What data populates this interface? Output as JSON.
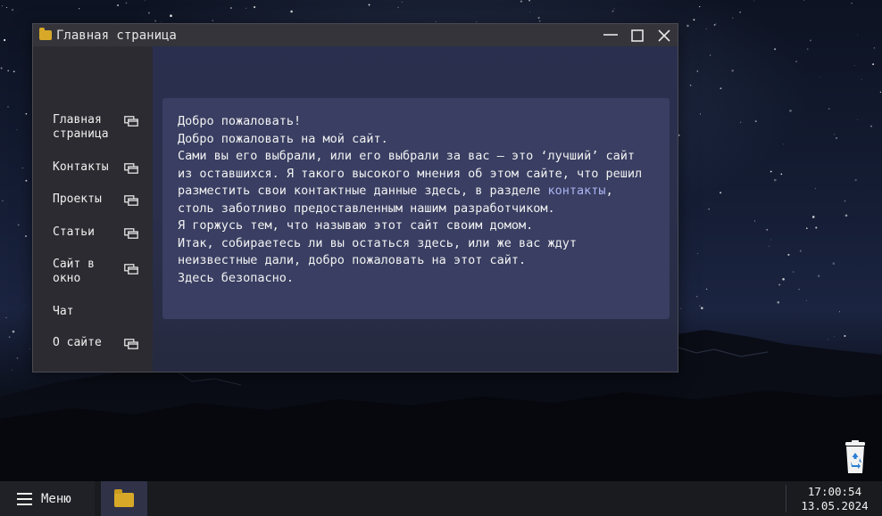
{
  "window": {
    "title": "Главная страница"
  },
  "sidebar": {
    "items": [
      {
        "label": "Главная страница",
        "icon": "window-icon"
      },
      {
        "label": "Контакты",
        "icon": "window-icon"
      },
      {
        "label": "Проекты",
        "icon": "window-icon"
      },
      {
        "label": "Статьи",
        "icon": "window-icon"
      },
      {
        "label": "Сайт в окно",
        "icon": "window-icon"
      },
      {
        "label": "Чат",
        "icon": ""
      },
      {
        "label": "О сайте",
        "icon": "window-icon"
      }
    ]
  },
  "content": {
    "line1": "Добро пожаловать!",
    "line2": "Добро пожаловать на мой сайт.",
    "para_a": "Сами вы его выбрали, или его выбрали за вас — это ‘лучший’ сайт из оставшихся. Я такого высокого мнения об этом сайте, что решил разместить свои контактные данные здесь, в разделе",
    "link": "контакты",
    "para_b": ", столь заботливо предоставленным нашим разработчиком.",
    "line3": "Я горжусь тем, что называю этот сайт своим домом.",
    "line4": "Итак, собираетесь ли вы остаться здесь, или же вас ждут неизвестные дали, добро пожаловать на этот сайт.",
    "line5": "Здесь безопасно."
  },
  "taskbar": {
    "menu_label": "Меню",
    "time": "17:00:54",
    "date": "13.05.2024"
  },
  "colors": {
    "folder": "#d8a928",
    "link": "#aab4f0",
    "card": "#393e62"
  }
}
